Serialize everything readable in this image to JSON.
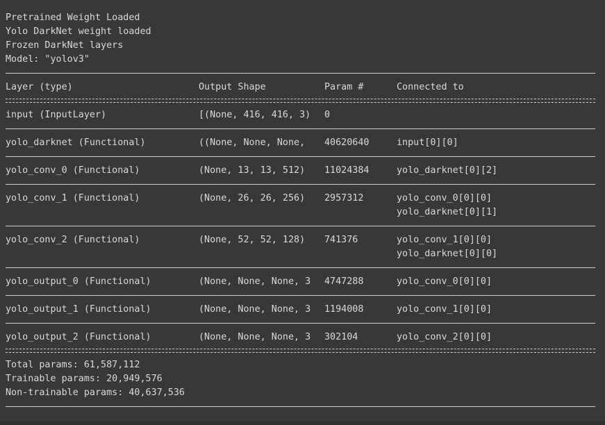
{
  "header": {
    "lines": [
      "Pretrained Weight Loaded",
      "Yolo DarkNet weight loaded",
      "Frozen DarkNet layers",
      "Model: \"yolov3\""
    ]
  },
  "summary": {
    "columns": {
      "layer": "Layer (type)",
      "shape": "Output Shape",
      "param": "Param #",
      "connected": "Connected to"
    },
    "rows": [
      {
        "layer": "input (InputLayer)",
        "shape": "[(None, 416, 416, 3)",
        "param": "0",
        "connected": [
          "",
          ""
        ]
      },
      {
        "layer": "yolo_darknet (Functional)",
        "shape": "((None, None, None,",
        "param": "40620640",
        "connected": [
          "input[0][0]",
          ""
        ]
      },
      {
        "layer": "yolo_conv_0 (Functional)",
        "shape": "(None, 13, 13, 512)",
        "param": "11024384",
        "connected": [
          "yolo_darknet[0][2]",
          ""
        ]
      },
      {
        "layer": "yolo_conv_1 (Functional)",
        "shape": "(None, 26, 26, 256)",
        "param": "2957312",
        "connected": [
          "yolo_conv_0[0][0]",
          "yolo_darknet[0][1]"
        ]
      },
      {
        "layer": "yolo_conv_2 (Functional)",
        "shape": "(None, 52, 52, 128)",
        "param": "741376",
        "connected": [
          "yolo_conv_1[0][0]",
          "yolo_darknet[0][0]"
        ]
      },
      {
        "layer": "yolo_output_0 (Functional)",
        "shape": "(None, None, None, 3",
        "param": "4747288",
        "connected": [
          "yolo_conv_0[0][0]",
          ""
        ]
      },
      {
        "layer": "yolo_output_1 (Functional)",
        "shape": "(None, None, None, 3",
        "param": "1194008",
        "connected": [
          "yolo_conv_1[0][0]",
          ""
        ]
      },
      {
        "layer": "yolo_output_2 (Functional)",
        "shape": "(None, None, None, 3",
        "param": "302104",
        "connected": [
          "yolo_conv_2[0][0]",
          ""
        ]
      }
    ],
    "totals": {
      "total": "Total params: 61,587,112",
      "trainable": "Trainable params: 20,949,576",
      "non_trainable": "Non-trainable params: 40,637,536"
    }
  },
  "colors": {
    "background": "#383838",
    "text": "#d9d9d9",
    "rule": "#cfcfcf"
  }
}
